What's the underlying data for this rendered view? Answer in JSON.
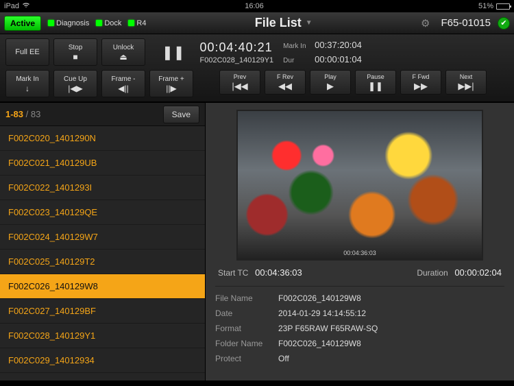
{
  "statusbar": {
    "device": "iPad",
    "time": "16:06",
    "battery_pct": "51%"
  },
  "titlebar": {
    "active": "Active",
    "leds": [
      "Diagnosis",
      "Dock",
      "R4"
    ],
    "title": "File List",
    "device_id": "F65-01015"
  },
  "controls_row1": {
    "full_ee": "Full EE",
    "stop": "Stop",
    "unlock": "Unlock"
  },
  "timecode": {
    "main_tc": "00:04:40:21",
    "clip_name": "F002C028_140129Y1",
    "mark_in_label": "Mark In",
    "mark_in": "00:37:20:04",
    "dur_label": "Dur",
    "dur": "00:00:01:04"
  },
  "controls_row2": {
    "mark_in": "Mark In",
    "cue_up": "Cue Up",
    "frame_minus": "Frame -",
    "frame_plus": "Frame +"
  },
  "transport": {
    "prev": "Prev",
    "frev": "F Rev",
    "play": "Play",
    "pause": "Pause",
    "ffwd": "F Fwd",
    "next": "Next"
  },
  "filelist": {
    "range_current": "1-83",
    "range_total": "83",
    "save": "Save",
    "items": [
      "F002C020_1401290N",
      "F002C021_140129UB",
      "F002C022_1401293I",
      "F002C023_140129QE",
      "F002C024_140129W7",
      "F002C025_140129T2",
      "F002C026_140129W8",
      "F002C027_140129BF",
      "F002C028_140129Y1",
      "F002C029_14012934"
    ],
    "selected_index": 6
  },
  "preview": {
    "osd_tc": "00:04:36:03",
    "start_tc_label": "Start TC",
    "start_tc": "00:04:36:03",
    "duration_label": "Duration",
    "duration": "00:00:02:04"
  },
  "meta": {
    "file_name_label": "File Name",
    "file_name": "F002C026_140129W8",
    "date_label": "Date",
    "date": "2014-01-29 14:14:55:12",
    "format_label": "Format",
    "format": " 23P  F65RAW F65RAW-SQ",
    "folder_label": "Folder Name",
    "folder": "F002C026_140129W8",
    "protect_label": "Protect",
    "protect": "Off"
  }
}
